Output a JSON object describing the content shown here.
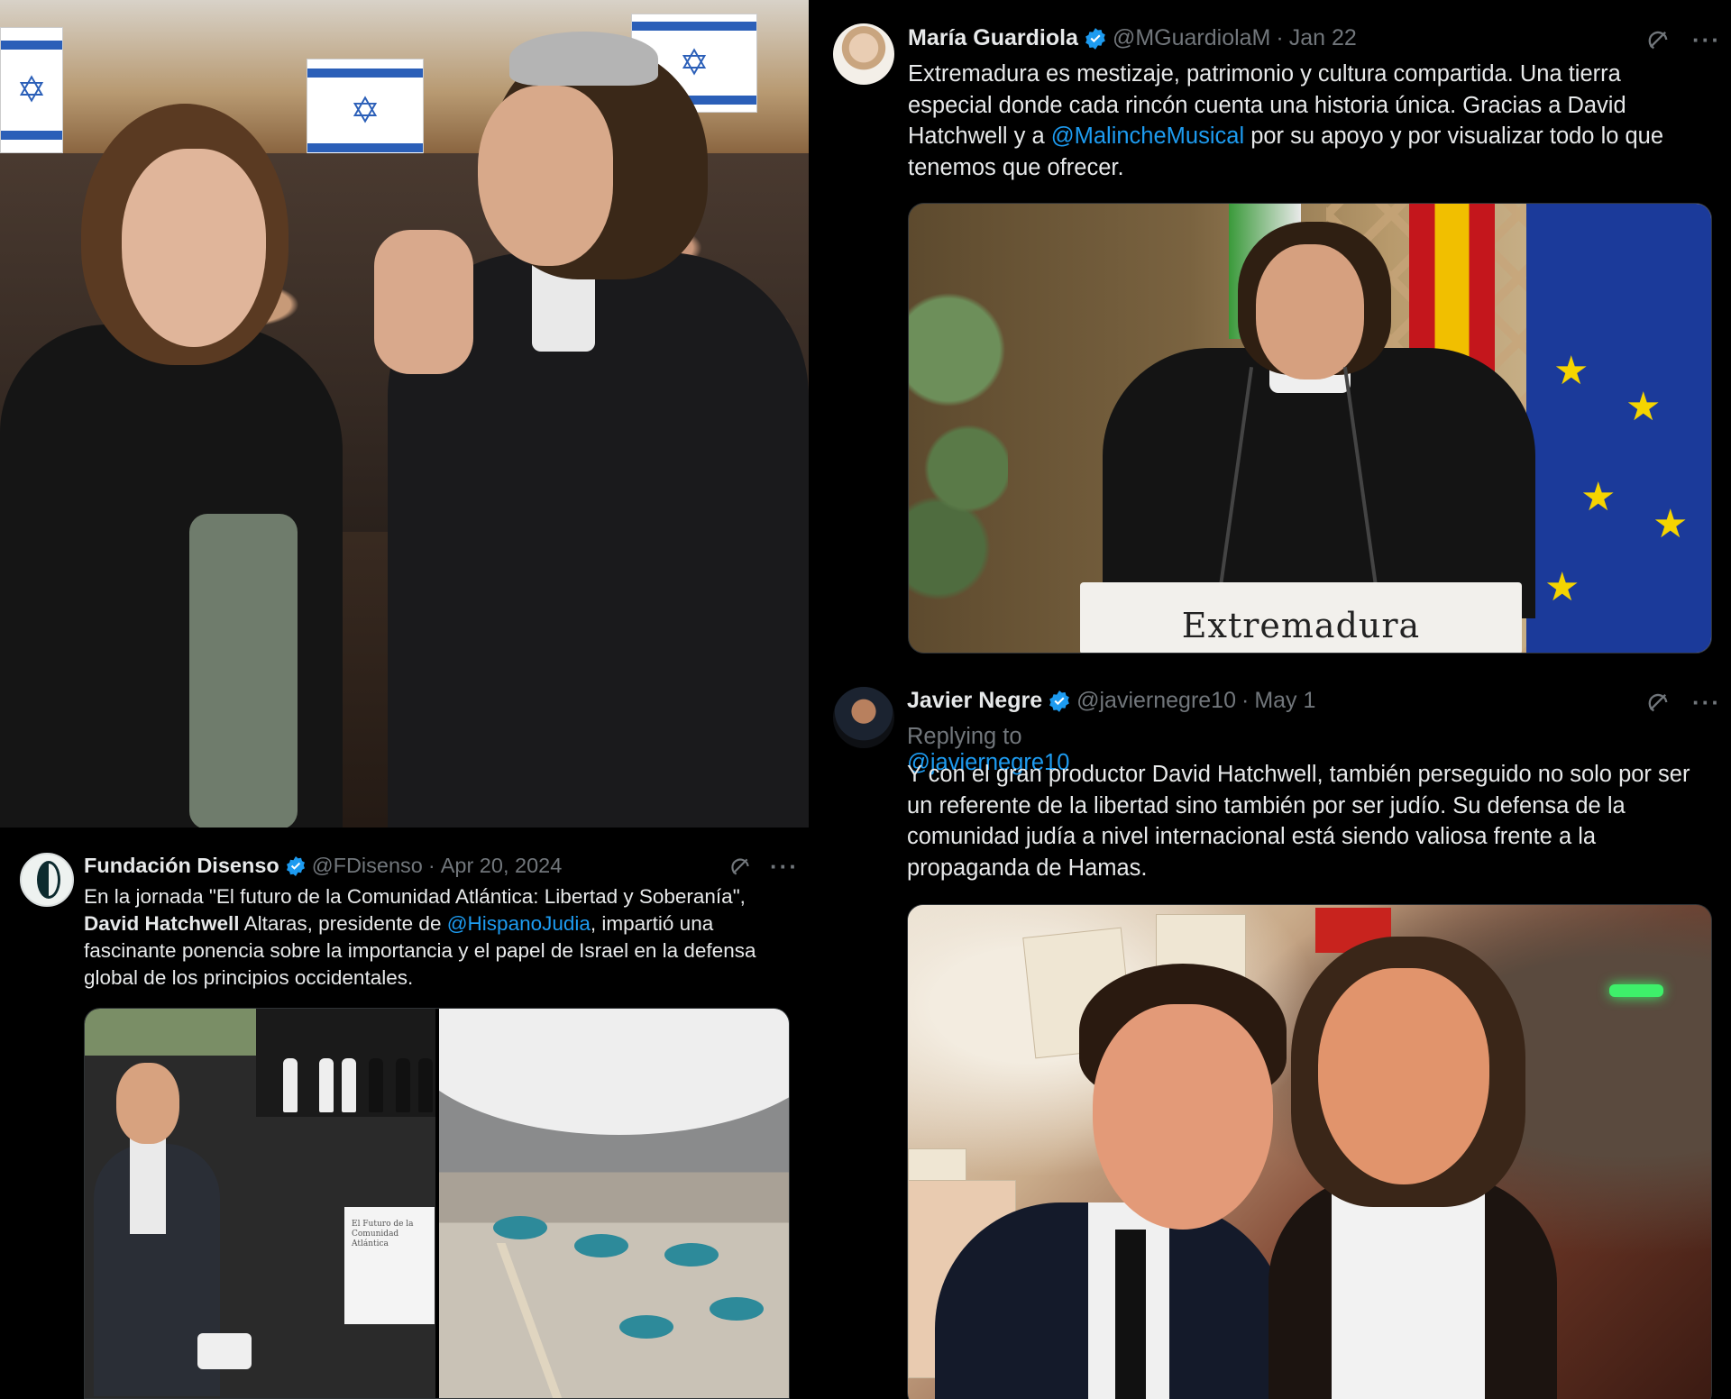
{
  "photo_panel": {
    "description_icon": "photo-icon"
  },
  "tweets": {
    "maria": {
      "display_name": "María Guardiola",
      "handle": "@MGuardiolaM",
      "dot": "·",
      "date": "Jan 22",
      "text_1": "Extremadura es mestizaje, patrimonio y cultura compartida. Una tierra especial donde cada rincón cuenta una historia única. Gracias a David Hatchwell y a ",
      "mention": "@MalincheMusical",
      "text_2": " por su apoyo y por visualizar todo lo que tenemos que ofrecer.",
      "media_podium_label": "Extremadura"
    },
    "javier": {
      "display_name": "Javier Negre",
      "handle": "@javiernegre10",
      "dot": "·",
      "date": "May 1",
      "replying_to_label": "Replying to ",
      "replying_to_handle": "@javiernegre10",
      "text": "Y con el gran productor David Hatchwell, también perseguido no solo por ser un referente de la libertad sino también por ser judío. Su defensa de la comunidad judía a nivel internacional está siendo valiosa frente a la propaganda de Hamas."
    },
    "fundacion": {
      "display_name": "Fundación Disenso",
      "handle": "@FDisenso",
      "dot": "·",
      "date": "Apr 20, 2024",
      "text_1": "En la jornada \"El futuro de la Comunidad Atlántica: Libertad y Soberanía\",",
      "bold_name": "David Hatchwell",
      "text_2": " Altaras, presidente de ",
      "mention": "@HispanoJudia",
      "text_3": ", impartió una fascinante ponencia sobre la importancia y el papel de Israel en la defensa global de los principios occidentales.",
      "lectern_text": "El Futuro de la Comunidad Atlántica"
    }
  },
  "actions": {
    "grok_icon": "grok-icon",
    "more_label": "···"
  },
  "colors": {
    "background": "#000000",
    "text": "#e7e9ea",
    "muted": "#71767b",
    "link": "#1d9bf0",
    "verified": "#1d9bf0"
  }
}
